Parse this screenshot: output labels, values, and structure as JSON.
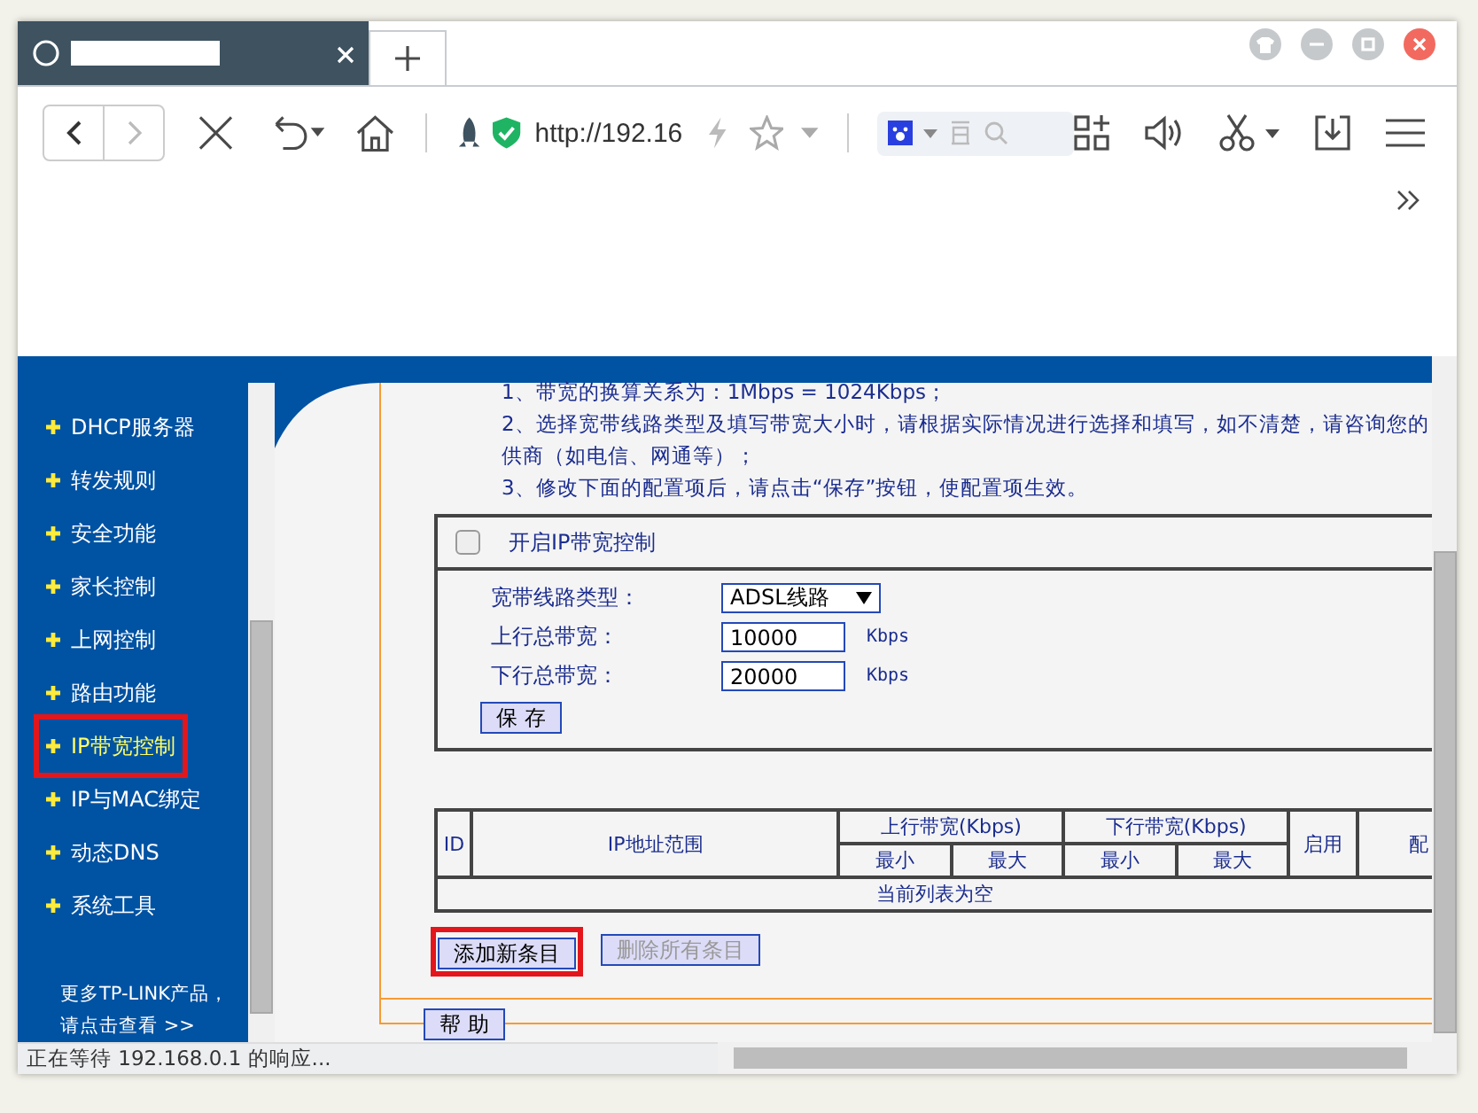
{
  "browser": {
    "address": "http://192.16"
  },
  "sidebar": {
    "items": [
      {
        "label": "DHCP服务器",
        "selected": false,
        "highlighted": false
      },
      {
        "label": "转发规则",
        "selected": false,
        "highlighted": false
      },
      {
        "label": "安全功能",
        "selected": false,
        "highlighted": false
      },
      {
        "label": "家长控制",
        "selected": false,
        "highlighted": false
      },
      {
        "label": "上网控制",
        "selected": false,
        "highlighted": false
      },
      {
        "label": "路由功能",
        "selected": false,
        "highlighted": false
      },
      {
        "label": "IP带宽控制",
        "selected": true,
        "highlighted": true
      },
      {
        "label": "IP与MAC绑定",
        "selected": false,
        "highlighted": false
      },
      {
        "label": "动态DNS",
        "selected": false,
        "highlighted": false
      },
      {
        "label": "系统工具",
        "selected": false,
        "highlighted": false
      }
    ],
    "footer_lines": [
      "更多TP-LINK产品，",
      "请点击查看 >>"
    ]
  },
  "notes": [
    "1、带宽的换算关系为：1Mbps = 1024Kbps；",
    "2、选择宽带线路类型及填写带宽大小时，请根据实际情况进行选择和填写，如不清楚，请咨询您的",
    "供商（如电信、网通等）；",
    "3、修改下面的配置项后，请点击“保存”按钮，使配置项生效。"
  ],
  "enable_control": {
    "label": "开启IP带宽控制",
    "checked": false
  },
  "fields": [
    {
      "kind": "select",
      "label": "宽带线路类型：",
      "value": "ADSL线路"
    },
    {
      "kind": "input",
      "label": "上行总带宽：",
      "value": "10000",
      "unit": "Kbps"
    },
    {
      "kind": "input",
      "label": "下行总带宽：",
      "value": "20000",
      "unit": "Kbps"
    }
  ],
  "save_button": "保 存",
  "table": {
    "id_column": "ID",
    "range_column": "IP地址范围",
    "groups": [
      {
        "label": "上行带宽(Kbps)",
        "min": "最小",
        "max": "最大"
      },
      {
        "label": "下行带宽(Kbps)",
        "min": "最小",
        "max": "最大"
      }
    ],
    "enabled_column": "启用",
    "column_7": "配",
    "empty_message": "当前列表为空"
  },
  "add_button": {
    "label": "添加新条目",
    "highlighted": true
  },
  "delete_all_button": {
    "label": "删除所有条目",
    "disabled": true
  },
  "help_button": "帮 助",
  "status_bar": "正在等待 192.168.0.1 的响应..."
}
